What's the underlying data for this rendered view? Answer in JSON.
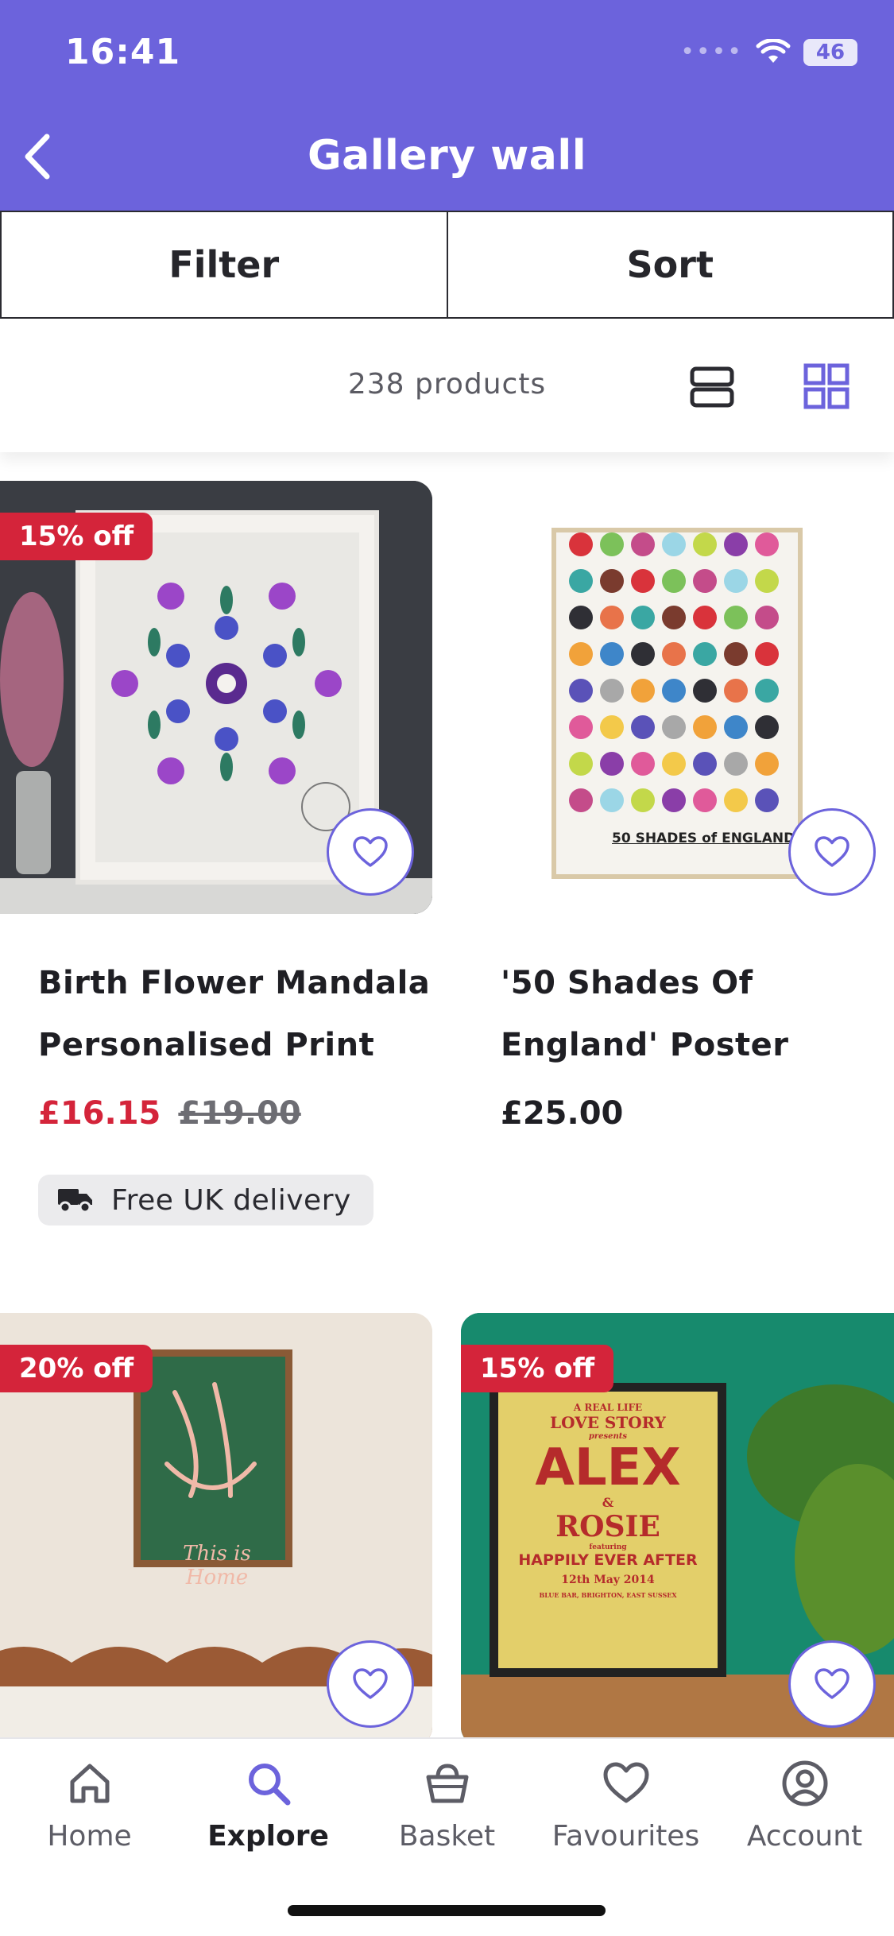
{
  "status_bar": {
    "time": "16:41",
    "signal": "••••",
    "battery": "46"
  },
  "header": {
    "title": "Gallery wall"
  },
  "toolbar": {
    "filter_label": "Filter",
    "sort_label": "Sort"
  },
  "results": {
    "count_text": "238 products"
  },
  "products": [
    {
      "badge": "15% off",
      "title_line1": "Birth Flower Mandala",
      "title_line2": "Personalised Print",
      "price": "£16.15",
      "old_price": "£19.00",
      "delivery": "Free UK delivery"
    },
    {
      "title_line1": "'50 Shades Of",
      "title_line2": "England' Poster",
      "price": "£25.00",
      "poster_caption": "50 SHADES of ENGLAND"
    },
    {
      "badge": "20% off",
      "poster_text": "This is Home"
    },
    {
      "badge": "15% off",
      "poster_lines": [
        "A REAL LIFE",
        "LOVE STORY",
        "presents",
        "ALEX",
        "&",
        "ROSIE",
        "featuring",
        "HAPPILY EVER AFTER",
        "12th May 2014",
        "BLUE BAR, BRIGHTON, EAST SUSSEX"
      ]
    }
  ],
  "bottom_nav": [
    {
      "label": "Home",
      "icon": "home-icon"
    },
    {
      "label": "Explore",
      "icon": "search-icon",
      "active": true
    },
    {
      "label": "Basket",
      "icon": "basket-icon"
    },
    {
      "label": "Favourites",
      "icon": "heart-icon"
    },
    {
      "label": "Account",
      "icon": "account-icon"
    }
  ],
  "colors": {
    "brand": "#6c63dc",
    "sale": "#d4243a"
  }
}
